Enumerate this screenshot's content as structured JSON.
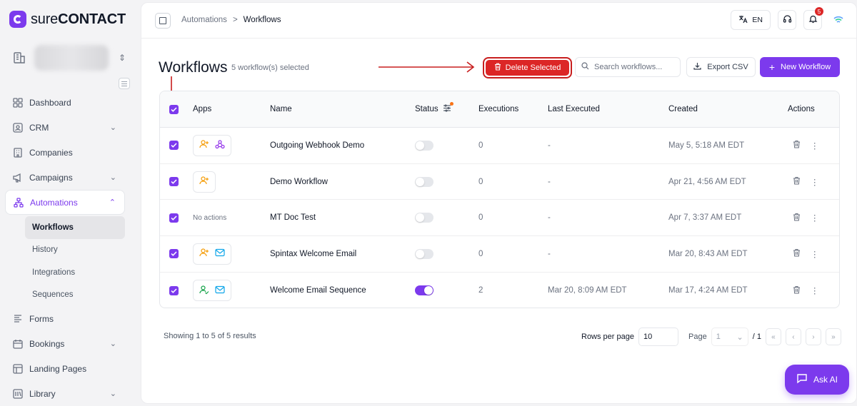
{
  "brand": {
    "name_light": "sure",
    "name_bold": "CONTACT",
    "accent": "#7c3aed",
    "danger": "#dc2626"
  },
  "sidebar": {
    "items": [
      {
        "label": "Dashboard",
        "icon": "dashboard-icon"
      },
      {
        "label": "CRM",
        "icon": "contact-card-icon",
        "has_children": true
      },
      {
        "label": "Companies",
        "icon": "building-icon"
      },
      {
        "label": "Campaigns",
        "icon": "megaphone-icon",
        "has_children": true
      },
      {
        "label": "Automations",
        "icon": "workflow-icon",
        "expanded": true,
        "active": true
      },
      {
        "label": "Forms",
        "icon": "form-icon"
      },
      {
        "label": "Bookings",
        "icon": "calendar-icon",
        "has_children": true
      },
      {
        "label": "Landing Pages",
        "icon": "layout-icon"
      },
      {
        "label": "Library",
        "icon": "library-icon",
        "has_children": true
      }
    ],
    "sub_items": [
      {
        "label": "Workflows",
        "active": true
      },
      {
        "label": "History"
      },
      {
        "label": "Integrations"
      },
      {
        "label": "Sequences"
      }
    ]
  },
  "breadcrumb": {
    "parent": "Automations",
    "separator": ">",
    "current": "Workflows"
  },
  "topbar": {
    "lang": "EN",
    "notification_count": "5"
  },
  "header": {
    "title": "Workflows",
    "selected_text": "5 workflow(s) selected",
    "delete_label": "Delete Selected",
    "search_placeholder": "Search workflows...",
    "export_label": "Export CSV",
    "new_label": "New Workflow"
  },
  "table": {
    "columns": [
      "Apps",
      "Name",
      "Status",
      "Executions",
      "Last Executed",
      "Created",
      "Actions"
    ],
    "rows": [
      {
        "apps": [
          "user-plus-icon",
          "webhook-icon"
        ],
        "apps_text": "",
        "name": "Outgoing Webhook Demo",
        "status_on": false,
        "executions": "0",
        "last_executed": "-",
        "created": "May 5, 5:18 AM EDT"
      },
      {
        "apps": [
          "user-plus-icon"
        ],
        "apps_text": "",
        "name": "Demo Workflow",
        "status_on": false,
        "executions": "0",
        "last_executed": "-",
        "created": "Apr 21, 4:56 AM EDT"
      },
      {
        "apps": [],
        "apps_text": "No actions",
        "name": "MT Doc Test",
        "status_on": false,
        "executions": "0",
        "last_executed": "-",
        "created": "Apr 7, 3:37 AM EDT"
      },
      {
        "apps": [
          "user-plus-icon",
          "mail-icon"
        ],
        "apps_text": "",
        "name": "Spintax Welcome Email",
        "status_on": false,
        "executions": "0",
        "last_executed": "-",
        "created": "Mar 20, 8:43 AM EDT"
      },
      {
        "apps": [
          "user-check-icon",
          "mail-icon"
        ],
        "apps_text": "",
        "name": "Welcome Email Sequence",
        "status_on": true,
        "executions": "2",
        "last_executed": "Mar 20, 8:09 AM EDT",
        "created": "Mar 17, 4:24 AM EDT"
      }
    ]
  },
  "footer": {
    "showing": "Showing 1 to 5 of 5 results",
    "rows_per_page_label": "Rows per page",
    "rows_per_page_value": "10",
    "page_label": "Page",
    "page_value": "1",
    "page_total": "/ 1"
  },
  "ask_ai": {
    "label": "Ask AI"
  }
}
